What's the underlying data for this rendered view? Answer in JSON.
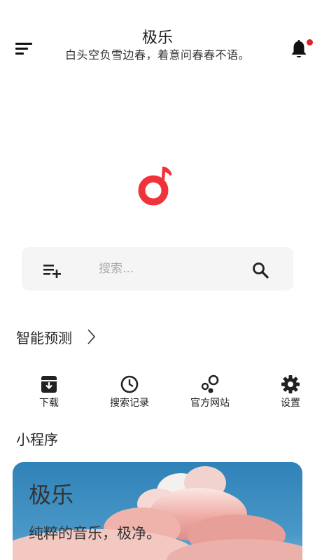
{
  "header": {
    "title": "极乐",
    "subtitle": "白头空负雪边春，着意问春春不语。",
    "menu_icon": "menu-icon",
    "bell_icon": "bell-icon",
    "notification_dot_color": "#e02424"
  },
  "logo": {
    "icon": "music-note-logo",
    "color": "#f0323a"
  },
  "search": {
    "placeholder": "搜索...",
    "value": "",
    "left_icon": "playlist-add-icon",
    "right_icon": "search-icon"
  },
  "smart_prediction": {
    "label": "智能预测",
    "icon": "chevron-right-icon"
  },
  "quick_actions": [
    {
      "label": "下载",
      "icon": "download-box-icon"
    },
    {
      "label": "搜索记录",
      "icon": "clock-icon"
    },
    {
      "label": "官方网站",
      "icon": "bubbles-icon"
    },
    {
      "label": "设置",
      "icon": "gear-icon"
    }
  ],
  "mini_program": {
    "section_title": "小程序",
    "card": {
      "title": "极乐",
      "subtitle": "纯粹的音乐，极净。",
      "sky_color": "#2f82b8",
      "cloud_color": "#e9a7a2"
    }
  }
}
